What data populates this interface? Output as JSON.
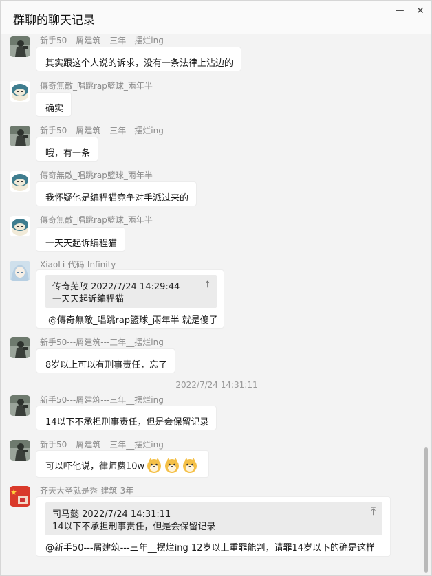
{
  "window": {
    "title": "群聊的聊天记录",
    "minimize_icon": "minimize-icon",
    "close_icon": "close-icon",
    "colors": {
      "bg": "#f3f3f3",
      "bubble": "#ffffff",
      "quote_bg": "#ebebeb",
      "nick": "#8a8a8a"
    }
  },
  "messages": [
    {
      "sender": "新手50---屑建筑---三年__摆烂ing",
      "text": "其实跟这个人说的诉求，没有一条法律上沾边的"
    },
    {
      "sender": "傳奇無敵_唱跳rap籃球_兩年半",
      "text": "确实"
    },
    {
      "sender": "新手50---屑建筑---三年__摆烂ing",
      "text": "哦，有一条"
    },
    {
      "sender": "傳奇無敵_唱跳rap籃球_兩年半",
      "text": "我怀疑他是编程猫竞争对手派过来的"
    },
    {
      "sender": "傳奇無敵_唱跳rap籃球_兩年半",
      "text": "一天天起诉编程猫"
    },
    {
      "sender": "XiaoLi-代码-Infinity",
      "quote_header": "传奇芜敌  2022/7/24 14:29:44",
      "quote_text": "一天天起诉编程猫",
      "text": "@傳奇無敵_唱跳rap籃球_兩年半 就是傻子"
    },
    {
      "sender": "新手50---屑建筑---三年__摆烂ing",
      "text": "8岁以上可以有刑事责任，忘了"
    },
    {
      "sender": "新手50---屑建筑---三年__摆烂ing",
      "text": "14以下不承担刑事责任，但是会保留记录"
    },
    {
      "sender": "新手50---屑建筑---三年__摆烂ing",
      "text": "可以吓他说，律师费10w",
      "emojis": [
        "doge-emoji",
        "doge-emoji",
        "doge-emoji"
      ]
    },
    {
      "sender": "齐天大圣就是秀-建筑-3年",
      "quote_header": "司马懿  2022/7/24 14:31:11",
      "quote_text": "14以下不承担刑事责任，但是会保留记录",
      "text": "@新手50---屑建筑---三年__摆烂ing 12岁以上重罪能判，请罪14岁以下的确是这样"
    }
  ],
  "timestamp_divider": "2022/7/24 14:31:11",
  "quote_icon": "jump-to-top-icon"
}
